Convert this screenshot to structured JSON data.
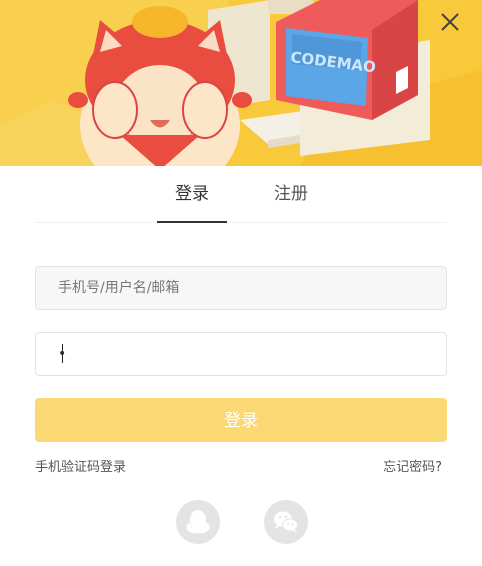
{
  "banner": {
    "screen_text": "CODEMAO",
    "background_color": "#f8c93a"
  },
  "close_icon": "close-icon",
  "tabs": {
    "login_label": "登录",
    "register_label": "注册",
    "active": "login"
  },
  "form": {
    "account_placeholder": "手机号/用户名/邮箱",
    "password_value": "•",
    "login_button_label": "登录",
    "accent_color": "#fcd874"
  },
  "links": {
    "sms_login": "手机验证码登录",
    "forgot_password": "忘记密码?"
  },
  "social": {
    "qq_icon": "qq-icon",
    "wechat_icon": "wechat-icon"
  }
}
